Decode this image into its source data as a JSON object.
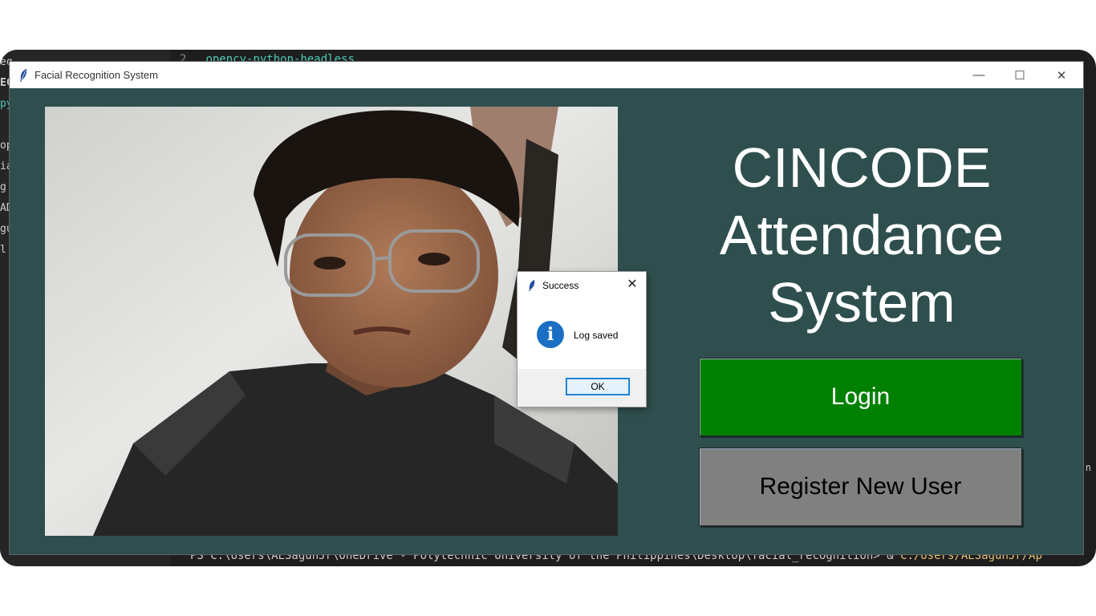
{
  "editor": {
    "sidebar_rows": [
      "eq",
      "EC",
      "py",
      "op",
      "ia",
      "g.t",
      "AD",
      "gu",
      "l.p"
    ],
    "line_number": "2",
    "line_text": "opencv-python-headless",
    "terminal_prompt": "PS C:\\Users\\AESagunJr\\OneDrive - Polytechnic University of the Philippines\\Desktop\\facial_recognition> & ",
    "terminal_path": "C:/Users/AESagunJr/Ap",
    "right_edge_text": "n"
  },
  "window": {
    "title": "Facial Recognition System",
    "icon": "feather-icon",
    "controls": {
      "minimize": "—",
      "maximize": "☐",
      "close": "✕"
    }
  },
  "main": {
    "heading": [
      "CINCODE",
      "Attendance",
      "System"
    ],
    "login_label": "Login",
    "register_label": "Register New User",
    "colors": {
      "background": "#2f4f4f",
      "login": "#008000",
      "register": "#808080"
    }
  },
  "dialog": {
    "title": "Success",
    "icon": "info-icon",
    "message": "Log saved",
    "ok_label": "OK",
    "close_glyph": "✕"
  }
}
